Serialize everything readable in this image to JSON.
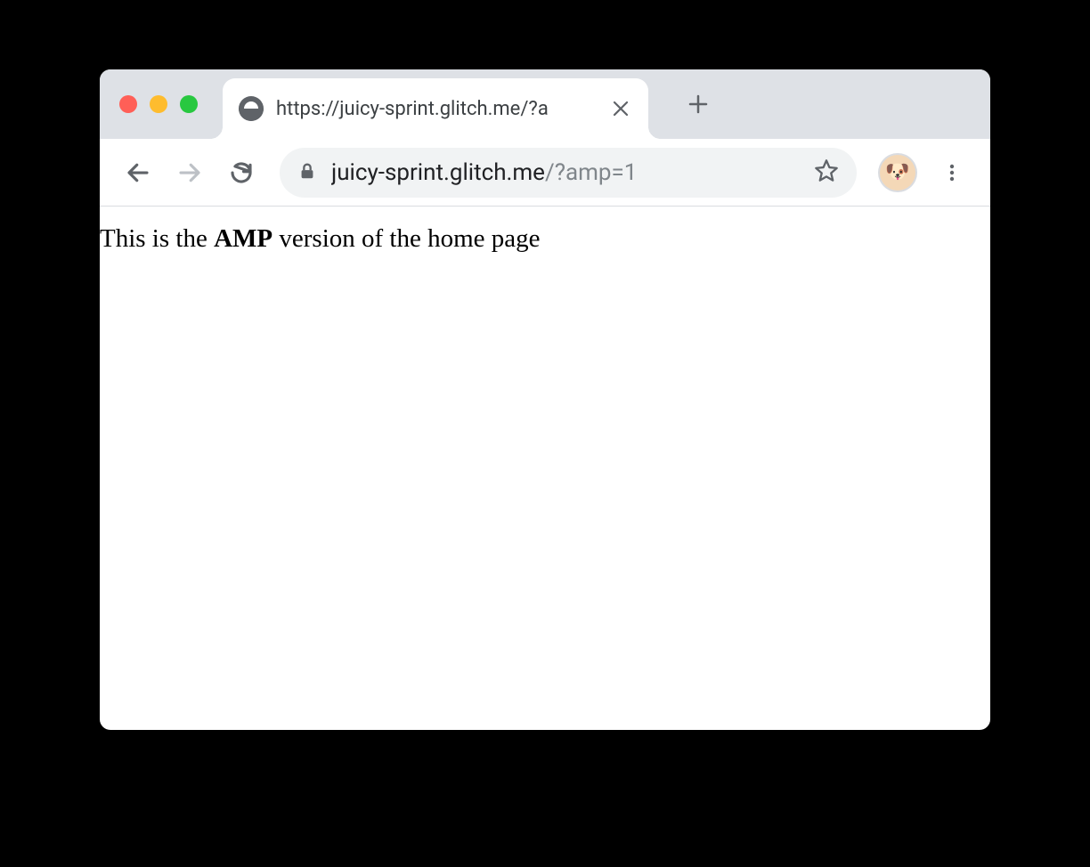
{
  "tab": {
    "title": "https://juicy-sprint.glitch.me/?a",
    "favicon": "globe-icon"
  },
  "address": {
    "host": "juicy-sprint.glitch.me",
    "path": "/?amp=1"
  },
  "profile": {
    "avatar": "🐶"
  },
  "content": {
    "prefix": "This is the ",
    "bold": "AMP",
    "suffix": " version of the home page"
  }
}
